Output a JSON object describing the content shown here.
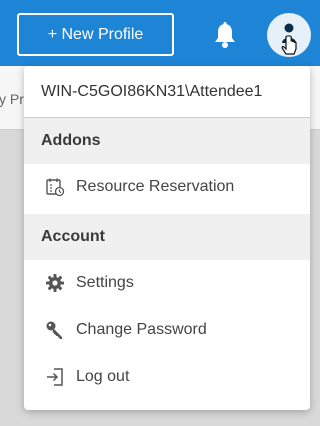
{
  "topbar": {
    "new_profile_label": "+ New Profile"
  },
  "subbar": {
    "partial_text": "y Pr"
  },
  "menu": {
    "user": "WIN-C5GOI86KN31\\Attendee1",
    "sections": [
      {
        "heading": "Addons",
        "items": [
          {
            "label": "Resource Reservation",
            "icon": "calendar-clock-icon"
          }
        ]
      },
      {
        "heading": "Account",
        "items": [
          {
            "label": "Settings",
            "icon": "gear-icon"
          },
          {
            "label": "Change Password",
            "icon": "key-icon"
          },
          {
            "label": "Log out",
            "icon": "logout-icon"
          }
        ]
      }
    ]
  },
  "colors": {
    "topbar": "#1e84d6",
    "menu_header_bg": "#f0f0f0"
  }
}
